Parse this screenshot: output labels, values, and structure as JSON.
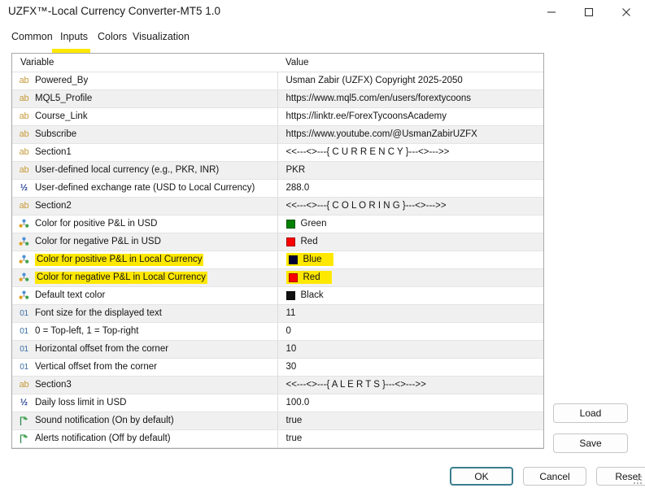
{
  "window": {
    "title": "UZFX™-Local Currency Converter-MT5 1.0",
    "controls": [
      {
        "name": "minimize",
        "label": "Minimize"
      },
      {
        "name": "maximize",
        "label": "Maximize"
      },
      {
        "name": "close",
        "label": "Close"
      }
    ]
  },
  "tabs": {
    "items": [
      {
        "label": "Common",
        "active": false
      },
      {
        "label": "Inputs",
        "active": true,
        "highlighted": true
      },
      {
        "label": "Colors",
        "active": false
      },
      {
        "label": "Visualization",
        "active": false
      }
    ]
  },
  "table": {
    "headers": {
      "variable": "Variable",
      "value": "Value"
    },
    "rows": [
      {
        "type": "string",
        "icon": "ab",
        "variable": "Powered_By",
        "value": "Usman Zabir (UZFX) Copyright 2025-2050"
      },
      {
        "type": "string",
        "icon": "ab",
        "variable": "MQL5_Profile",
        "value": "https://www.mql5.com/en/users/forextycoons"
      },
      {
        "type": "string",
        "icon": "ab",
        "variable": "Course_Link",
        "value": "https://linktr.ee/ForexTycoonsAcademy"
      },
      {
        "type": "string",
        "icon": "ab",
        "variable": "Subscribe",
        "value": "https://www.youtube.com/@UsmanZabirUZFX"
      },
      {
        "type": "string",
        "icon": "ab",
        "variable": "Section1",
        "value": "<<---<>---{ C U R R E N C Y }---<>--->>"
      },
      {
        "type": "string",
        "icon": "ab",
        "variable": "User-defined local currency (e.g., PKR, INR)",
        "value": "PKR"
      },
      {
        "type": "double",
        "icon": "1/2",
        "variable": "User-defined exchange rate (USD to Local Currency)",
        "value": "288.0"
      },
      {
        "type": "string",
        "icon": "ab",
        "variable": "Section2",
        "value": "<<---<>---{ C O L O R I N G }---<>--->>"
      },
      {
        "type": "color",
        "icon": "color",
        "variable": "Color for positive P&L in USD",
        "value": "Green",
        "swatch": "#008000"
      },
      {
        "type": "color",
        "icon": "color",
        "variable": "Color for negative P&L in USD",
        "value": "Red",
        "swatch": "#ff0000"
      },
      {
        "type": "color",
        "icon": "color",
        "variable": "Color for positive P&L in Local Currency",
        "value": "Blue",
        "swatch": "#000033",
        "highlight_variable": true,
        "highlight_value": true
      },
      {
        "type": "color",
        "icon": "color",
        "variable": "Color for negative P&L in Local Currency",
        "value": "Red",
        "swatch": "#ff0000",
        "highlight_variable": true,
        "highlight_value": true
      },
      {
        "type": "color",
        "icon": "color",
        "variable": "Default text color",
        "value": "Black",
        "swatch": "#111111"
      },
      {
        "type": "int",
        "icon": "01",
        "variable": "Font size for the displayed text",
        "value": "11"
      },
      {
        "type": "int",
        "icon": "01",
        "variable": "0 = Top-left, 1 = Top-right",
        "value": "0"
      },
      {
        "type": "int",
        "icon": "01",
        "variable": "Horizontal offset from the corner",
        "value": "10"
      },
      {
        "type": "int",
        "icon": "01",
        "variable": "Vertical offset from the corner",
        "value": "30"
      },
      {
        "type": "string",
        "icon": "ab",
        "variable": "Section3",
        "value": "<<---<>---{ A L E R T S }---<>--->>"
      },
      {
        "type": "double",
        "icon": "1/2",
        "variable": "Daily loss limit in USD",
        "value": "100.0"
      },
      {
        "type": "bool",
        "icon": "flag",
        "variable": "Sound notification (On by default)",
        "value": "true"
      },
      {
        "type": "bool",
        "icon": "flag",
        "variable": "Alerts notification (Off by default)",
        "value": "true"
      }
    ]
  },
  "side_buttons": [
    {
      "label": "Load"
    },
    {
      "label": "Save"
    }
  ],
  "bottom_buttons": [
    {
      "label": "OK",
      "default": true
    },
    {
      "label": "Cancel",
      "default": false
    },
    {
      "label": "Reset",
      "default": false
    }
  ],
  "colors": {
    "highlight": "#ffe800",
    "focus_border": "#3a7e8c",
    "row_alt": "#f0f0f0",
    "frame_border": "#a8a8a8"
  }
}
